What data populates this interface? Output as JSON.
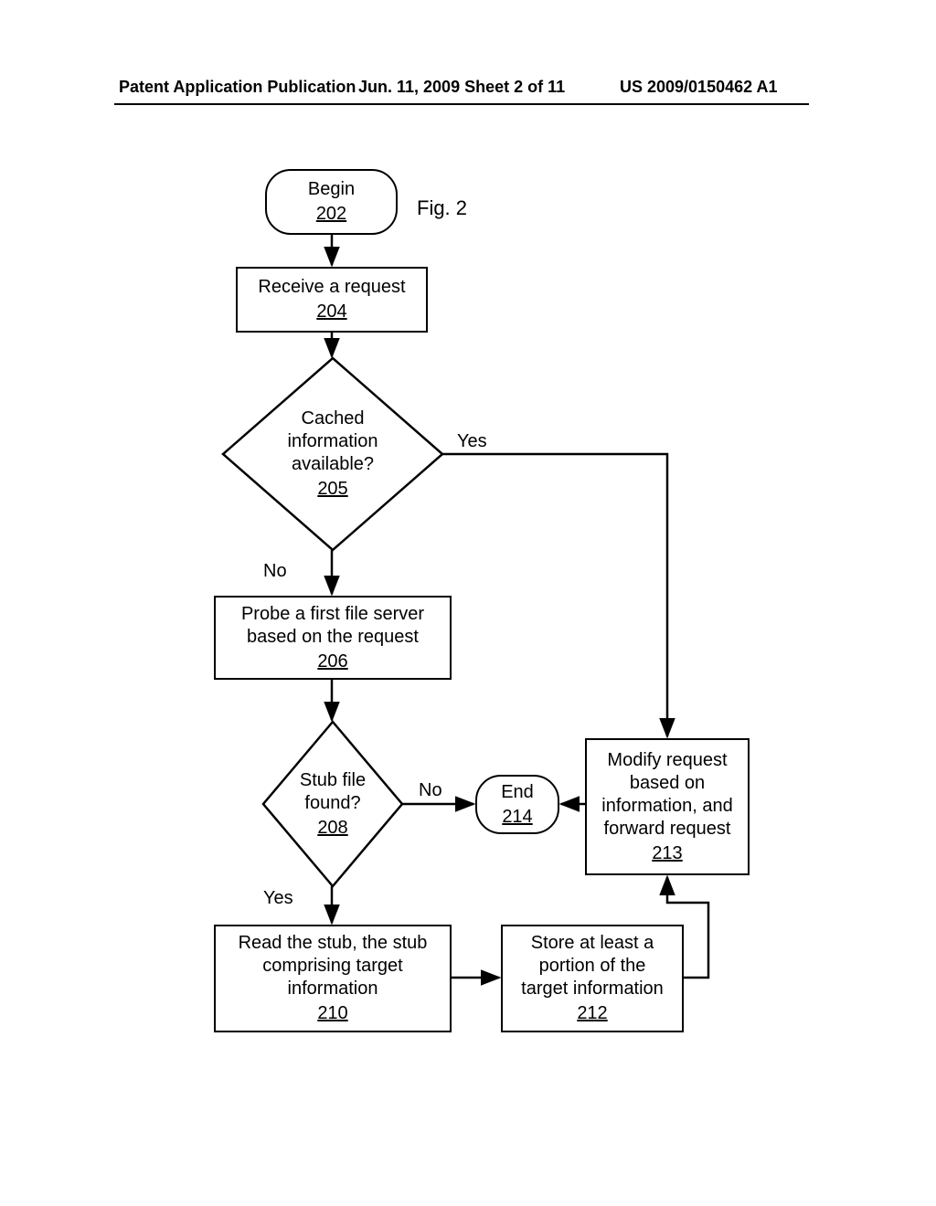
{
  "header": {
    "left": "Patent Application Publication",
    "mid": "Jun. 11, 2009  Sheet 2 of 11",
    "right": "US 2009/0150462 A1"
  },
  "figure_label": "Fig. 2",
  "nodes": {
    "begin": {
      "text": "Begin",
      "ref": "202"
    },
    "receive": {
      "text": "Receive a request",
      "ref": "204"
    },
    "cached": {
      "line1": "Cached",
      "line2": "information",
      "line3": "available?",
      "ref": "205"
    },
    "probe": {
      "line1": "Probe a first file server",
      "line2": "based on the request",
      "ref": "206"
    },
    "stub_found": {
      "line1": "Stub file",
      "line2": "found?",
      "ref": "208"
    },
    "end": {
      "text": "End",
      "ref": "214"
    },
    "modify": {
      "line1": "Modify request",
      "line2": "based on",
      "line3": "information, and",
      "line4": "forward request",
      "ref": "213"
    },
    "read": {
      "line1": "Read the stub, the stub",
      "line2": "comprising target",
      "line3": "information",
      "ref": "210"
    },
    "store": {
      "line1": "Store at least a",
      "line2": "portion of the",
      "line3": "target information",
      "ref": "212"
    }
  },
  "labels": {
    "cached_yes": "Yes",
    "cached_no": "No",
    "stub_no": "No",
    "stub_yes": "Yes"
  }
}
